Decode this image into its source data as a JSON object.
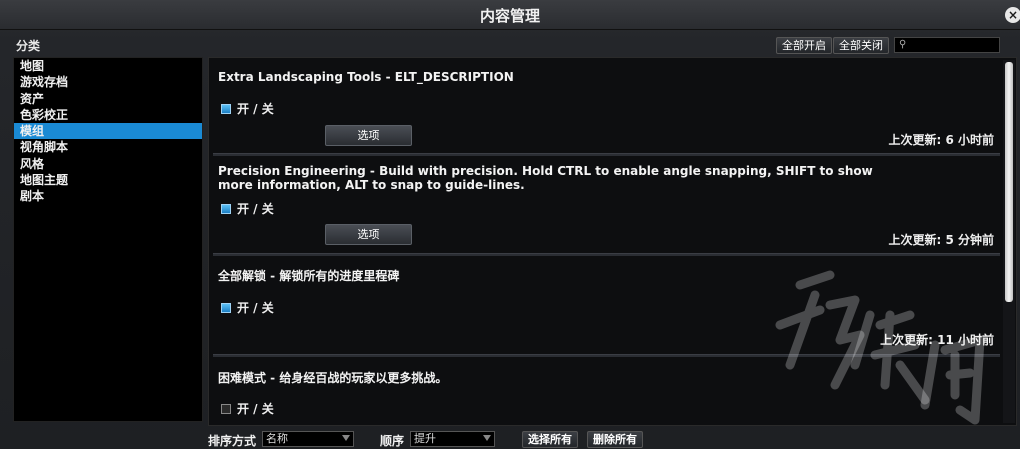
{
  "window": {
    "title": "内容管理",
    "close_symbol": "×"
  },
  "categories": {
    "label": "分类",
    "items": [
      {
        "label": "地图",
        "selected": false
      },
      {
        "label": "游戏存档",
        "selected": false
      },
      {
        "label": "资产",
        "selected": false
      },
      {
        "label": "色彩校正",
        "selected": false
      },
      {
        "label": "模组",
        "selected": true
      },
      {
        "label": "视角脚本",
        "selected": false
      },
      {
        "label": "风格",
        "selected": false
      },
      {
        "label": "地图主题",
        "selected": false
      },
      {
        "label": "剧本",
        "selected": false
      }
    ]
  },
  "toolbar": {
    "enable_all_label": "全部开启",
    "disable_all_label": "全部关闭",
    "search_icon": "search-icon",
    "search_value": ""
  },
  "mods": [
    {
      "name": "Extra Landscaping Tools - ELT_DESCRIPTION",
      "toggle_label": "开 / 关",
      "enabled": true,
      "options_label": "选项",
      "updated": "上次更新: 6 小时前"
    },
    {
      "name": "Precision Engineering - Build with precision. Hold CTRL to enable angle snapping, SHIFT to show more information, ALT to snap to guide-lines.",
      "toggle_label": "开 / 关",
      "enabled": true,
      "options_label": "选项",
      "updated": "上次更新: 5 分钟前"
    },
    {
      "name": "全部解锁 - 解锁所有的进度里程碑",
      "toggle_label": "开 / 关",
      "enabled": true,
      "updated": "上次更新: 11 小时前"
    },
    {
      "name": "困难模式 - 给身经百战的玩家以更多挑战。",
      "toggle_label": "开 / 关",
      "enabled": false
    }
  ],
  "bottom": {
    "sort_label": "排序方式",
    "sort_value": "名称",
    "order_label": "顺序",
    "order_value": "提升",
    "select_all_label": "选择所有",
    "delete_all_label": "删除所有"
  },
  "colors": {
    "accent": "#1a8ad4",
    "checkbox_on": "#3aa3e6"
  }
}
